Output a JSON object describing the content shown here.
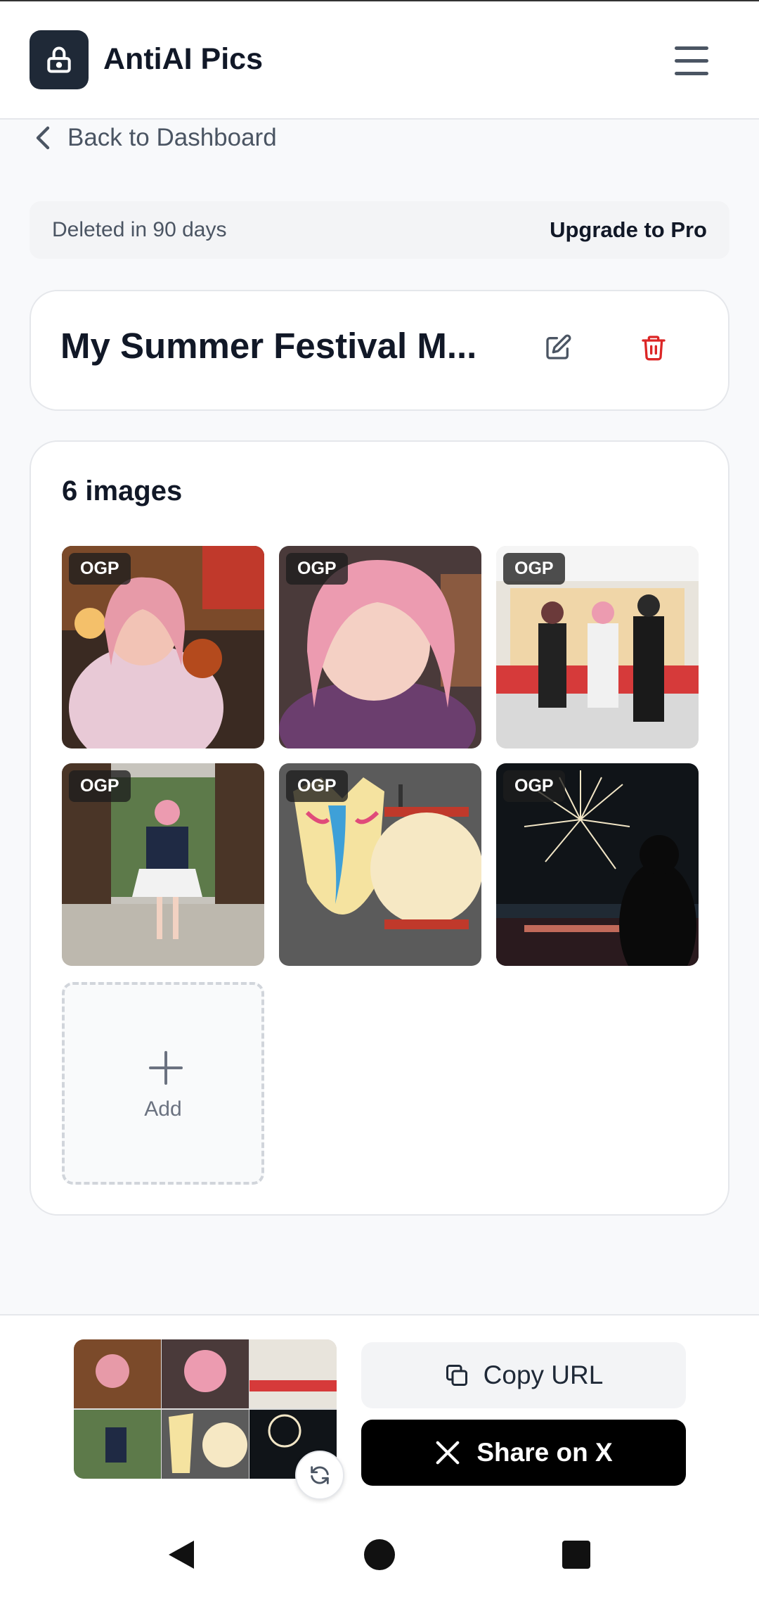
{
  "header": {
    "title": "AntiAI Pics",
    "menu_icon": "hamburger-menu-icon",
    "logo_icon": "lock-icon"
  },
  "nav": {
    "back_label": "Back to Dashboard"
  },
  "plan": {
    "retention_text": "Deleted in 90 days",
    "upgrade_label": "Upgrade to Pro"
  },
  "album": {
    "title": "My Summer Festival M...",
    "edit_icon": "edit-icon",
    "delete_icon": "trash-icon"
  },
  "images": {
    "count_label": "6 images",
    "badge": "OGP",
    "items": [
      {
        "description": "cosplayer with candy apple at festival"
      },
      {
        "description": "cosplayer winking selfie"
      },
      {
        "description": "three cosplayers on stage"
      },
      {
        "description": "cosplayer at temple gate"
      },
      {
        "description": "fox mask and paper lantern"
      },
      {
        "description": "fireworks over river"
      }
    ],
    "add_label": "Add"
  },
  "share": {
    "copy_label": "Copy URL",
    "share_label": "Share on X"
  },
  "colors": {
    "accent_dark": "#1f2937",
    "danger": "#dc2626",
    "share_bg": "#000000"
  }
}
